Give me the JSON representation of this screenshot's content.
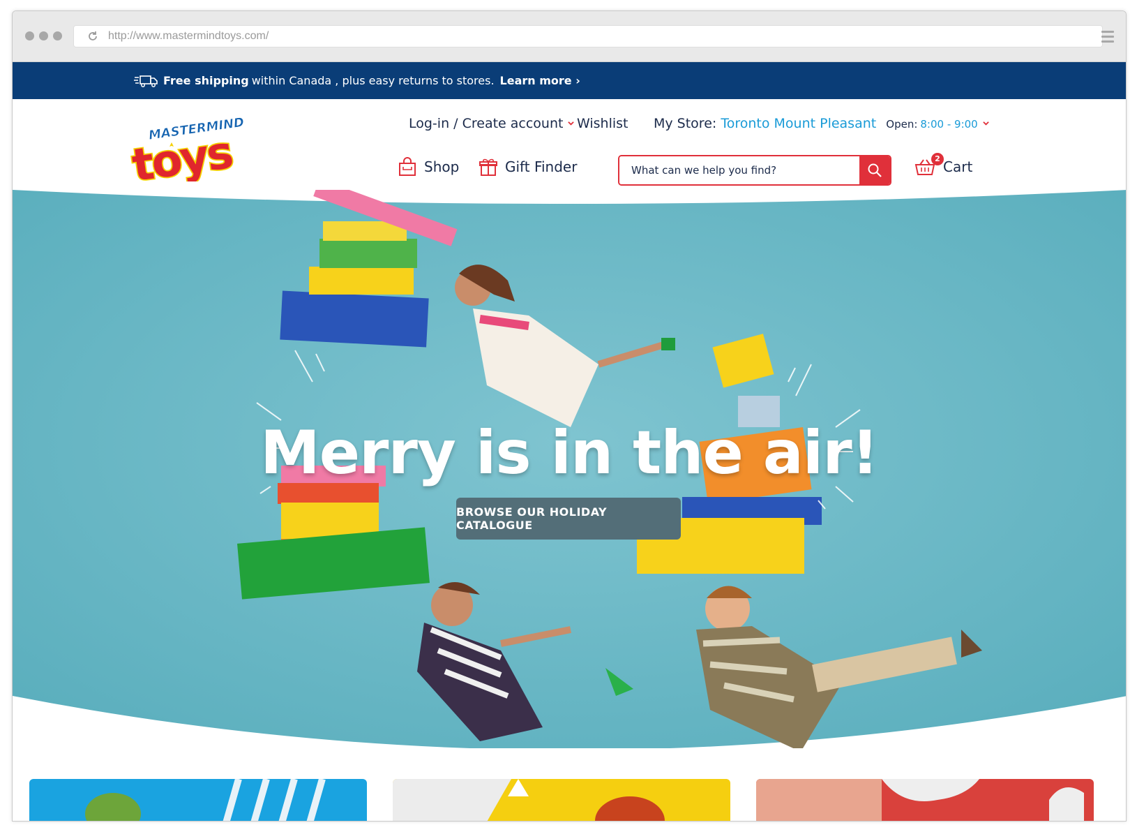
{
  "browser": {
    "url": "http://www.mastermindtoys.com/"
  },
  "promo": {
    "bold": "Free shipping",
    "text": "within Canada , plus easy returns to stores.",
    "link": "Learn more ›",
    "icon": "truck-icon"
  },
  "logo": {
    "top": "MASTERMIND",
    "main": "toys"
  },
  "topnav": {
    "login": "Log-in / Create account",
    "wishlist": "Wishlist",
    "store_label": "My Store:",
    "store_name": "Toronto Mount Pleasant",
    "open_label": "Open:",
    "open_hours": "8:00 - 9:00"
  },
  "mainnav": {
    "shop": "Shop",
    "gift_finder": "Gift Finder",
    "search_placeholder": "What can we help you find?",
    "cart_label": "Cart",
    "cart_count": "2"
  },
  "hero": {
    "headline": "Merry is in the air!",
    "cta": "BROWSE OUR HOLIDAY CATALOGUE"
  },
  "colors": {
    "navy": "#0a3d77",
    "accent_red": "#e0303a",
    "link_blue": "#1a9bd7",
    "hero_bg": "#6cb8c6",
    "cta_bg": "#536e78"
  }
}
